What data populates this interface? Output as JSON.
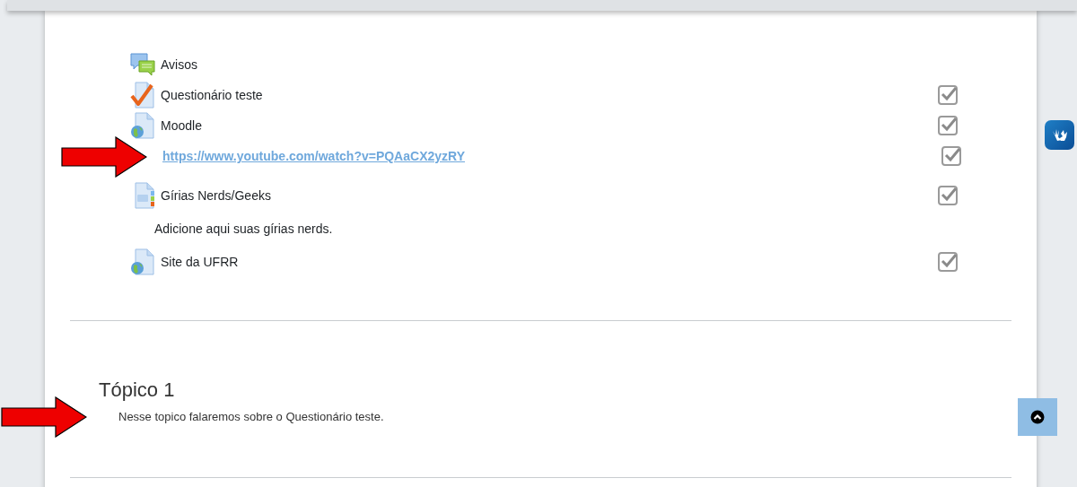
{
  "activities": [
    {
      "kind": "forum",
      "name": "Avisos"
    },
    {
      "kind": "quiz",
      "name": "Questionário teste",
      "completed": true
    },
    {
      "kind": "url",
      "name": "Moodle",
      "completed": true
    },
    {
      "kind": "link",
      "name": "https://www.youtube.com/watch?v=PQAaCX2yzRY",
      "completed": true,
      "marked": true
    },
    {
      "kind": "glossary",
      "name": "Gírias Nerds/Geeks",
      "completed": true
    },
    {
      "kind": "description",
      "name": "Adicione aqui suas gírias nerds."
    },
    {
      "kind": "url",
      "name": "Site da UFRR",
      "completed": true
    }
  ],
  "section": {
    "title": "Tópico 1",
    "summary": "Nesse topico falaremos sobre o Questionário teste.",
    "marked": true
  }
}
